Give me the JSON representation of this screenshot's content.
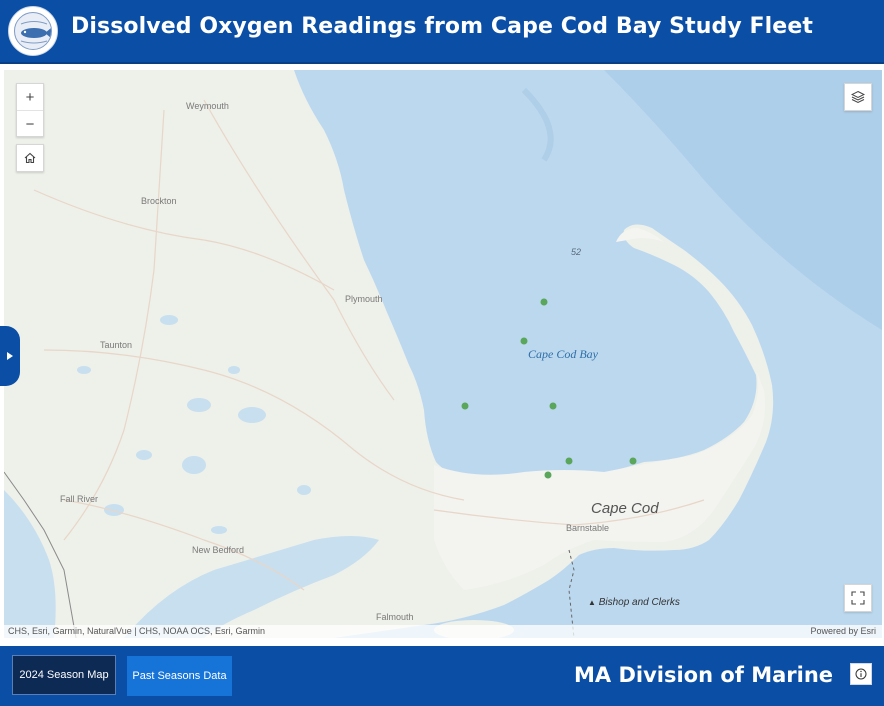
{
  "header": {
    "title": "Dissolved Oxygen Readings from Cape Cod Bay Study Fleet",
    "logo_icon": "ma-division-marine-fisheries-seal-icon"
  },
  "map": {
    "controls": {
      "zoom_in": "+",
      "zoom_out": "−",
      "home_icon": "home-icon",
      "layers_icon": "layers-icon",
      "fullscreen_icon": "fullscreen-icon",
      "side_panel_icon": "chevron-right-icon"
    },
    "labels": {
      "weymouth": "Weymouth",
      "brockton": "Brockton",
      "plymouth": "Plymouth",
      "taunton": "Taunton",
      "fall_river": "Fall River",
      "new_bedford": "New Bedford",
      "falmouth": "Falmouth",
      "barnstable": "Barnstable",
      "cape_cod_bay": "Cape Cod Bay",
      "cape_cod": "Cape Cod",
      "bishop_and_clerks": "Bishop and Clerks",
      "depth": "52"
    },
    "attribution_left": "CHS, Esri, Garmin, NaturalVue | CHS, NOAA OCS, Esri, Garmin",
    "attribution_right": "Powered by Esri",
    "reading_point_color": "#5aa65a",
    "reading_point_count": 7
  },
  "footer": {
    "season_button": "2024 Season Map",
    "past_button": "Past Seasons Data",
    "org_title": "MA Division of Marine",
    "info_icon": "info-icon"
  },
  "colors": {
    "header_bg": "#0a4ea6",
    "water": "#bcd8ee",
    "land": "#eef0ea"
  }
}
